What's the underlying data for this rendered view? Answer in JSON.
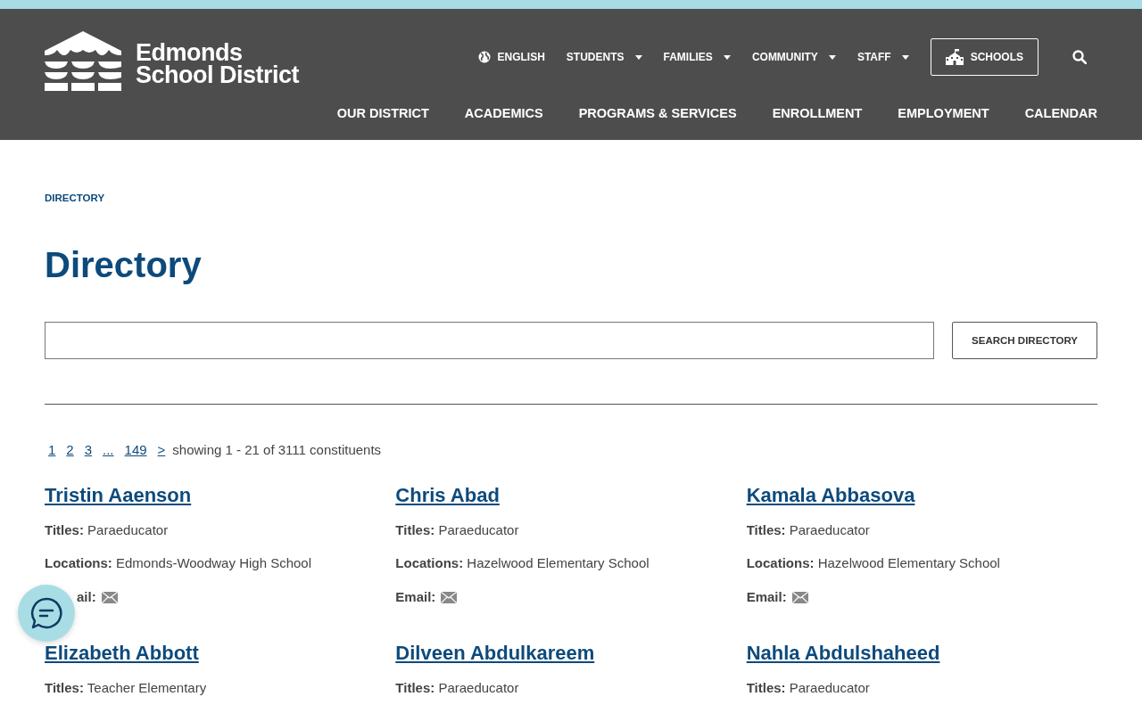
{
  "logo": {
    "line_1": "Edmonds",
    "line_2": "School District"
  },
  "utility_nav": [
    {
      "label": "ENGLISH",
      "kind": "language"
    },
    {
      "label": "STUDENTS",
      "kind": "dropdown"
    },
    {
      "label": "FAMILIES",
      "kind": "dropdown"
    },
    {
      "label": "COMMUNITY",
      "kind": "dropdown"
    },
    {
      "label": "STAFF",
      "kind": "dropdown"
    }
  ],
  "schools_button": "SCHOOLS",
  "main_nav": [
    "OUR DISTRICT",
    "ACADEMICS",
    "PROGRAMS & SERVICES",
    "ENROLLMENT",
    "EMPLOYMENT",
    "CALENDAR"
  ],
  "breadcrumb": "DIRECTORY",
  "page_title": "Directory",
  "search_button": "SEARCH DIRECTORY",
  "pagination": {
    "pages": [
      "1",
      "2",
      "3",
      "...",
      "149",
      ">"
    ],
    "summary": "showing 1 - 21 of 3111 constituents"
  },
  "people": [
    {
      "name": "Tristin Aaenson",
      "fields": [
        {
          "label": "Titles:",
          "value": "Paraeducator"
        },
        {
          "label": "Locations:",
          "value": "Edmonds-Woodway High School"
        }
      ],
      "email_label": "ail:",
      "email_label_covered": true
    },
    {
      "name": "Chris Abad",
      "fields": [
        {
          "label": "Titles:",
          "value": "Paraeducator"
        },
        {
          "label": "Locations:",
          "value": "Hazelwood Elementary School"
        }
      ],
      "email_label": "Email:"
    },
    {
      "name": "Kamala Abbasova",
      "fields": [
        {
          "label": "Titles:",
          "value": "Paraeducator"
        },
        {
          "label": "Locations:",
          "value": "Hazelwood Elementary School"
        }
      ],
      "email_label": "Email:"
    },
    {
      "name": "Elizabeth Abbott",
      "fields": [
        {
          "label": "Titles:",
          "value": "Teacher Elementary"
        }
      ]
    },
    {
      "name": "Dilveen Abdulkareem",
      "fields": [
        {
          "label": "Titles:",
          "value": "Paraeducator"
        }
      ]
    },
    {
      "name": "Nahla Abdulshaheed",
      "fields": [
        {
          "label": "Titles:",
          "value": "Paraeducator"
        }
      ]
    }
  ]
}
